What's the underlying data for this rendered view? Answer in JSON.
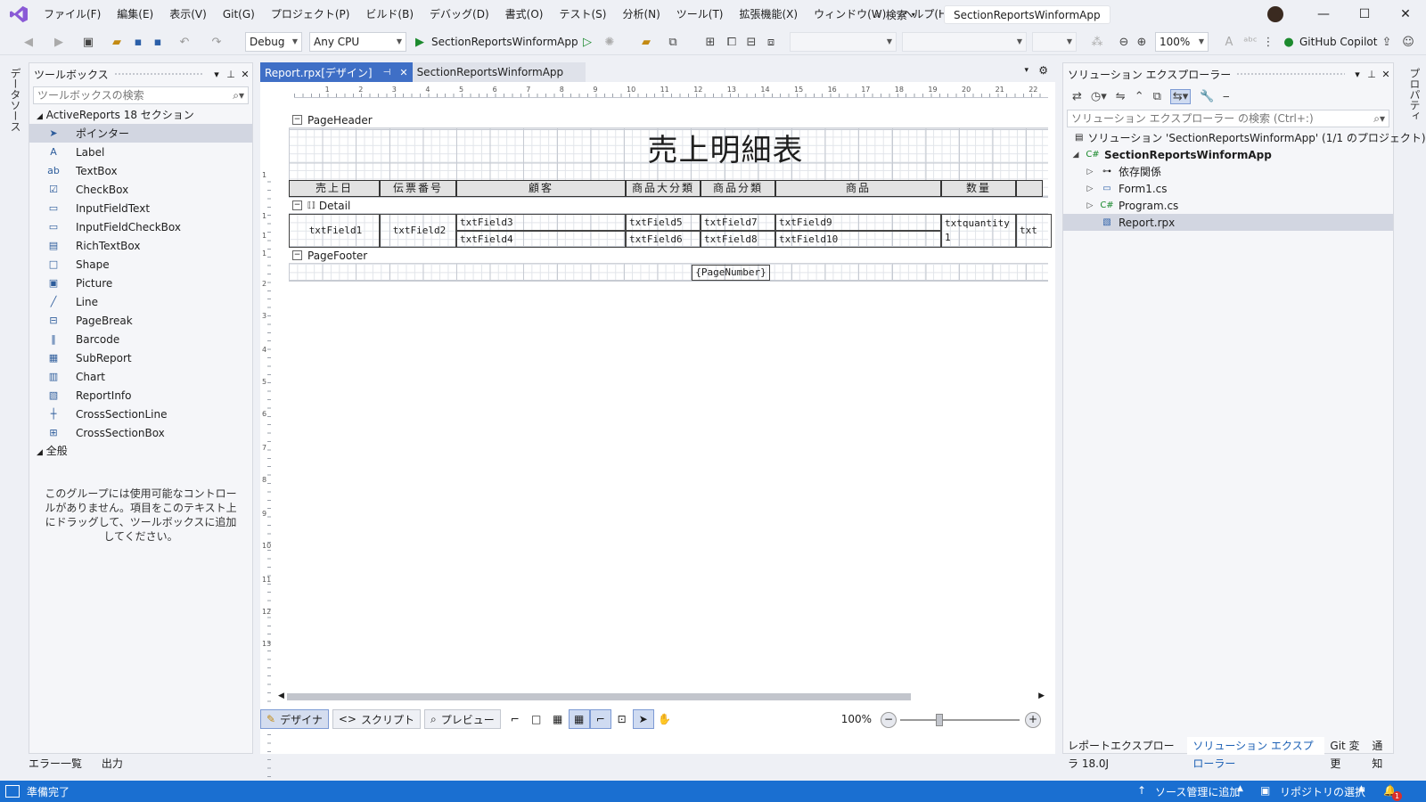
{
  "menu": [
    "ファイル(F)",
    "編集(E)",
    "表示(V)",
    "Git(G)",
    "プロジェクト(P)",
    "ビルド(B)",
    "デバッグ(D)",
    "書式(O)",
    "テスト(S)",
    "分析(N)",
    "ツール(T)",
    "拡張機能(X)",
    "ウィンドウ(W)",
    "ヘルプ(H)"
  ],
  "search_label": "検索",
  "app_title": "SectionReportsWinformApp",
  "toolbar": {
    "config": "Debug",
    "platform": "Any CPU",
    "run_target": "SectionReportsWinformApp",
    "zoom": "100%",
    "copilot": "GitHub Copilot"
  },
  "left_strip_label": "データソース",
  "toolbox": {
    "title": "ツールボックス",
    "search_placeholder": "ツールボックスの検索",
    "group1": "ActiveReports 18 セクション",
    "items": [
      {
        "label": "ポインター",
        "icon": "pointer-icon",
        "glyph": "➤"
      },
      {
        "label": "Label",
        "icon": "label-icon",
        "glyph": "A"
      },
      {
        "label": "TextBox",
        "icon": "textbox-icon",
        "glyph": "ab"
      },
      {
        "label": "CheckBox",
        "icon": "checkbox-icon",
        "glyph": "☑"
      },
      {
        "label": "InputFieldText",
        "icon": "inputfieldtext-icon",
        "glyph": "▭"
      },
      {
        "label": "InputFieldCheckBox",
        "icon": "inputfieldcheckbox-icon",
        "glyph": "▭"
      },
      {
        "label": "RichTextBox",
        "icon": "richtextbox-icon",
        "glyph": "▤"
      },
      {
        "label": "Shape",
        "icon": "shape-icon",
        "glyph": "□"
      },
      {
        "label": "Picture",
        "icon": "picture-icon",
        "glyph": "▣"
      },
      {
        "label": "Line",
        "icon": "line-icon",
        "glyph": "╱"
      },
      {
        "label": "PageBreak",
        "icon": "pagebreak-icon",
        "glyph": "⊟"
      },
      {
        "label": "Barcode",
        "icon": "barcode-icon",
        "glyph": "‖"
      },
      {
        "label": "SubReport",
        "icon": "subreport-icon",
        "glyph": "▦"
      },
      {
        "label": "Chart",
        "icon": "chart-icon",
        "glyph": "▥"
      },
      {
        "label": "ReportInfo",
        "icon": "reportinfo-icon",
        "glyph": "▧"
      },
      {
        "label": "CrossSectionLine",
        "icon": "crosssectionline-icon",
        "glyph": "┼"
      },
      {
        "label": "CrossSectionBox",
        "icon": "crosssectionbox-icon",
        "glyph": "⊞"
      }
    ],
    "group2": "全般",
    "empty_note": "このグループには使用可能なコントロールがありません。項目をこのテキスト上にドラッグして、ツールボックスに追加してください。"
  },
  "bottom_tabs": [
    "エラー一覧",
    "出力"
  ],
  "doc_tabs": {
    "active": "Report.rpx[デザイン]",
    "inactive": "SectionReportsWinformApp"
  },
  "report": {
    "sections": {
      "header": "PageHeader",
      "detail": "Detail",
      "footer": "PageFooter"
    },
    "title": "売上明細表",
    "columns": [
      "売上日",
      "伝票番号",
      "顧客",
      "商品大分類",
      "商品分類",
      "商品",
      "数量"
    ],
    "detail_fields": [
      "txtField1",
      "txtField2",
      "txtField3",
      "txtField4",
      "txtField5",
      "txtField6",
      "txtField7",
      "txtField8",
      "txtField9",
      "txtField10",
      "txtquantity1",
      "txt"
    ],
    "footer_field": "{PageNumber}",
    "ruler_h": [
      "1",
      "2",
      "3",
      "4",
      "5",
      "6",
      "7",
      "8",
      "9",
      "10",
      "11",
      "12",
      "13",
      "14",
      "15",
      "16",
      "17",
      "18",
      "19",
      "20",
      "21",
      "22"
    ],
    "ruler_v": [
      "1",
      "1",
      "1",
      "1",
      "2",
      "3",
      "4",
      "5",
      "6",
      "7",
      "8",
      "9",
      "10",
      "11",
      "12",
      "13"
    ]
  },
  "doc_bottom": {
    "design": "デザイナ",
    "script": "スクリプト",
    "preview": "プレビュー",
    "zoom": "100%"
  },
  "solution": {
    "title": "ソリューション エクスプローラー",
    "search_placeholder": "ソリューション エクスプローラー の検索 (Ctrl+:)",
    "solution_label": "ソリューション 'SectionReportsWinformApp' (1/1 のプロジェクト)",
    "project": "SectionReportsWinformApp",
    "items": [
      "依存関係",
      "Form1.cs",
      "Program.cs",
      "Report.rpx"
    ]
  },
  "right_tabs": [
    "レポートエクスプローラ 18.0J",
    "ソリューション エクスプローラー",
    "Git 変更",
    "通知"
  ],
  "right_strip_label": "プロパティ",
  "status": {
    "ready": "準備完了",
    "source_control": "ソース管理に追加",
    "repo": "リポジトリの選択",
    "notif_count": "1"
  }
}
